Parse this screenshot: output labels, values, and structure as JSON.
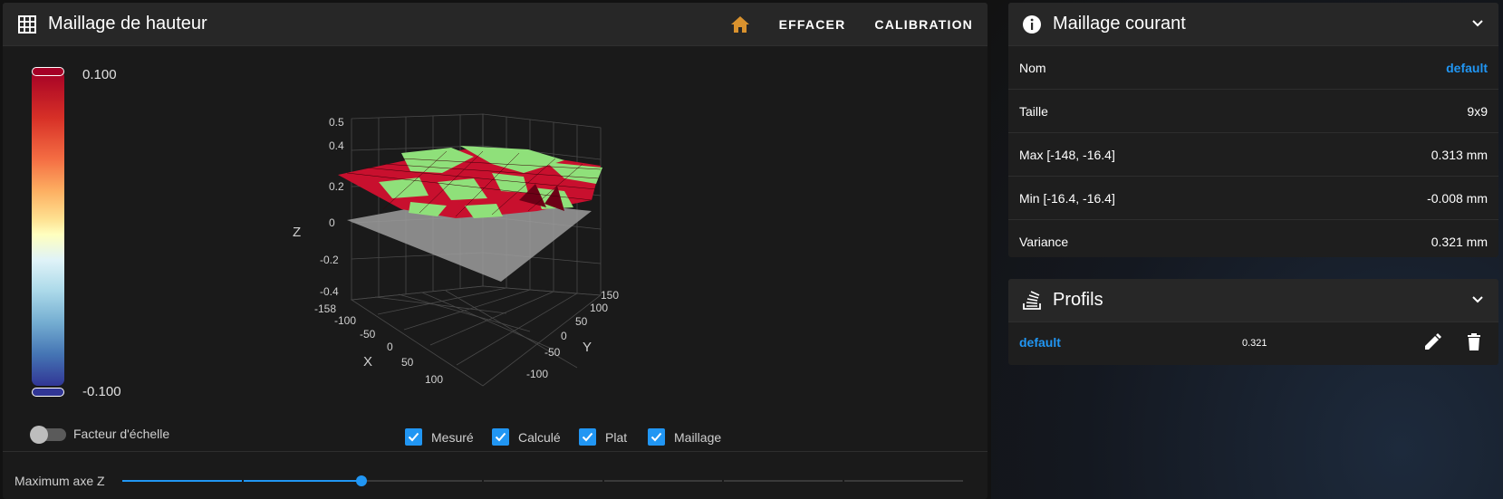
{
  "heightmap": {
    "title": "Maillage de hauteur",
    "buttons": {
      "clear": "EFFACER",
      "calibration": "CALIBRATION"
    },
    "legend": {
      "max": "0.100",
      "min": "-0.100"
    },
    "scale_toggle_label": "Facteur d'échelle",
    "scale_toggle_on": false,
    "checkboxes": [
      {
        "label": "Mesuré",
        "checked": true
      },
      {
        "label": "Calculé",
        "checked": true
      },
      {
        "label": "Plat",
        "checked": true
      },
      {
        "label": "Maillage",
        "checked": true
      }
    ],
    "zmax_label": "Maximum axe Z",
    "zmax_slider_value": 0.284,
    "accent_color": "#2196f3",
    "home_icon_color": "#d9922e",
    "plot": {
      "z_axis_label": "Z",
      "x_axis_label": "X",
      "y_axis_label": "Y",
      "z_ticks": [
        "0.5",
        "0.4",
        "0.2",
        "0",
        "-0.2",
        "-0.4"
      ],
      "x_ticks": [
        "-158",
        "-100",
        "-50",
        "0",
        "50",
        "100"
      ],
      "y_ticks": [
        "150",
        "100",
        "50",
        "0",
        "-50",
        "-100"
      ]
    }
  },
  "current_mesh": {
    "title": "Maillage courant",
    "rows": [
      {
        "label": "Nom",
        "value": "default"
      },
      {
        "label": "Taille",
        "value": "9x9"
      },
      {
        "label": "Max [-148, -16.4]",
        "value": "0.313 mm"
      },
      {
        "label": "Min [-16.4, -16.4]",
        "value": "-0.008 mm"
      },
      {
        "label": "Variance",
        "value": "0.321 mm"
      }
    ]
  },
  "profiles": {
    "title": "Profils",
    "items": [
      {
        "name": "default",
        "variance": "0.321"
      }
    ]
  }
}
